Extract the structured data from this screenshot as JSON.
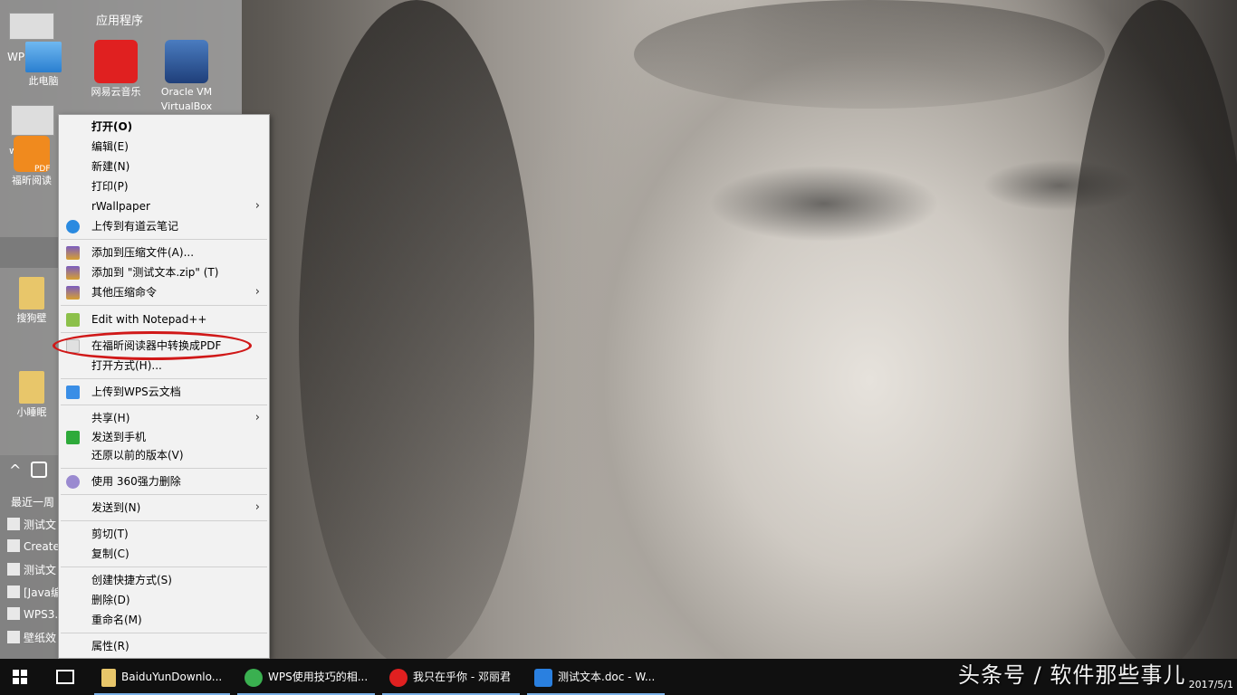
{
  "start_panel": {
    "header": "应用程序",
    "tiles": [
      {
        "label": "此电脑",
        "icon": "computer-icon"
      },
      {
        "label": "网易云音乐",
        "icon": "netease-music-icon"
      },
      {
        "label": "Oracle VM VirtualBox",
        "icon": "virtualbox-icon"
      },
      {
        "label": "福昕阅读",
        "icon": "foxit-reader-icon"
      },
      {
        "label": "搜狗壁",
        "icon": "folder-icon"
      },
      {
        "label": "小睡眠",
        "icon": "folder-icon"
      }
    ],
    "wps_label": "WPS",
    "wp_label": "wp",
    "pdf_label": "PDF",
    "recent_title": "最近一周",
    "recent_items": [
      "测试文",
      "Create",
      "测试文",
      "[Java编",
      "WPS3.",
      "壁纸效"
    ]
  },
  "context_menu": {
    "items": [
      {
        "label": "打开(O)",
        "bold": true
      },
      {
        "label": "编辑(E)"
      },
      {
        "label": "新建(N)"
      },
      {
        "label": "打印(P)"
      },
      {
        "label": "rWallpaper",
        "submenu": true
      },
      {
        "label": "上传到有道云笔记",
        "icon": "youdao-note-icon"
      },
      {
        "label": "添加到压缩文件(A)...",
        "icon": "winrar-icon"
      },
      {
        "label": "添加到 \"测试文本.zip\" (T)",
        "icon": "winrar-icon"
      },
      {
        "label": "其他压缩命令",
        "icon": "winrar-icon",
        "submenu": true
      },
      {
        "label": "Edit with Notepad++",
        "icon": "notepadpp-icon"
      },
      {
        "label": "在福昕阅读器中转换成PDF",
        "icon": "foxit-icon"
      },
      {
        "label": "打开方式(H)..."
      },
      {
        "label": "上传到WPS云文档",
        "icon": "wps-cloud-icon"
      },
      {
        "label": "共享(H)",
        "submenu": true
      },
      {
        "label": "发送到手机",
        "icon": "send-phone-icon"
      },
      {
        "label": "还原以前的版本(V)"
      },
      {
        "label": "使用 360强力删除",
        "icon": "360-icon"
      },
      {
        "label": "发送到(N)",
        "submenu": true
      },
      {
        "label": "剪切(T)"
      },
      {
        "label": "复制(C)"
      },
      {
        "label": "创建快捷方式(S)"
      },
      {
        "label": "删除(D)"
      },
      {
        "label": "重命名(M)"
      },
      {
        "label": "属性(R)"
      }
    ]
  },
  "taskbar": {
    "items": [
      {
        "label": "BaiduYunDownlo...",
        "icon": "folder-icon"
      },
      {
        "label": "WPS使用技巧的相...",
        "icon": "browser-icon"
      },
      {
        "label": "我只在乎你 - 邓丽君",
        "icon": "netease-music-icon"
      },
      {
        "label": "测试文本.doc - W...",
        "icon": "wps-writer-icon"
      }
    ],
    "tray_text": "^",
    "clock": "2017/5/1"
  },
  "watermark": "头条号 / 软件那些事儿",
  "colors": {
    "menu_bg": "#f2f2f2",
    "highlight_circle": "#d01818",
    "taskbar_bg": "#101010"
  }
}
